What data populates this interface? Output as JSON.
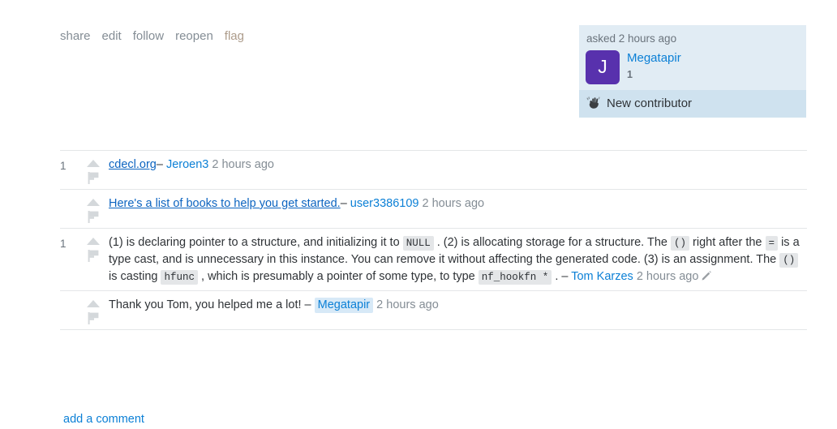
{
  "post_menu": {
    "items": [
      {
        "label": "share",
        "name": "share"
      },
      {
        "label": "edit",
        "name": "edit"
      },
      {
        "label": "follow",
        "name": "follow"
      },
      {
        "label": "reopen",
        "name": "reopen"
      },
      {
        "label": "flag",
        "name": "flag"
      }
    ]
  },
  "owner_card": {
    "asked_label": "asked 2 hours ago",
    "avatar_letter": "J",
    "avatar_color": "#5831ad",
    "username": "Megatapir",
    "reputation": "1",
    "badge_label": "New contributor",
    "badge_icon": "waving-hand-icon",
    "card_bg": "#e1ecf4",
    "badge_bg": "#cfe2ef"
  },
  "comments": [
    {
      "score": "1",
      "parts": [
        {
          "type": "link",
          "text": "cdecl.org"
        }
      ],
      "dash": "–",
      "author": "Jeroen3",
      "author_is_owner": false,
      "date": "2 hours ago",
      "edited": false
    },
    {
      "score": "",
      "parts": [
        {
          "type": "link",
          "text": "Here's a list of books to help you get started."
        }
      ],
      "dash": "–",
      "author": "user3386109",
      "author_is_owner": false,
      "date": "2 hours ago",
      "edited": false
    },
    {
      "score": "1",
      "parts": [
        {
          "type": "text",
          "text": "(1) is declaring pointer to a structure, and initializing it to "
        },
        {
          "type": "code",
          "text": "NULL"
        },
        {
          "type": "text",
          "text": ". (2) is allocating storage for a structure. The "
        },
        {
          "type": "code",
          "text": "()"
        },
        {
          "type": "text",
          "text": " right after the "
        },
        {
          "type": "code",
          "text": "="
        },
        {
          "type": "text",
          "text": " is a type cast, and is unnecessary in this instance. You can remove it without affecting the generated code. (3) is an assignment. The "
        },
        {
          "type": "code",
          "text": "()"
        },
        {
          "type": "text",
          "text": " is casting "
        },
        {
          "type": "code",
          "text": "hfunc"
        },
        {
          "type": "text",
          "text": ", which is presumably a pointer of some type, to type "
        },
        {
          "type": "code",
          "text": "nf_hookfn *"
        },
        {
          "type": "text",
          "text": ". "
        }
      ],
      "dash": "–",
      "author": "Tom Karzes",
      "author_is_owner": false,
      "date": "2 hours ago",
      "edited": true,
      "edit_icon": "pencil-icon"
    },
    {
      "score": "",
      "parts": [
        {
          "type": "text",
          "text": "Thank you Tom, you helped me a lot! "
        }
      ],
      "dash": "–",
      "author": "Megatapir",
      "author_is_owner": true,
      "date": "2 hours ago",
      "edited": false
    }
  ],
  "add_comment": {
    "label": "add a comment"
  }
}
